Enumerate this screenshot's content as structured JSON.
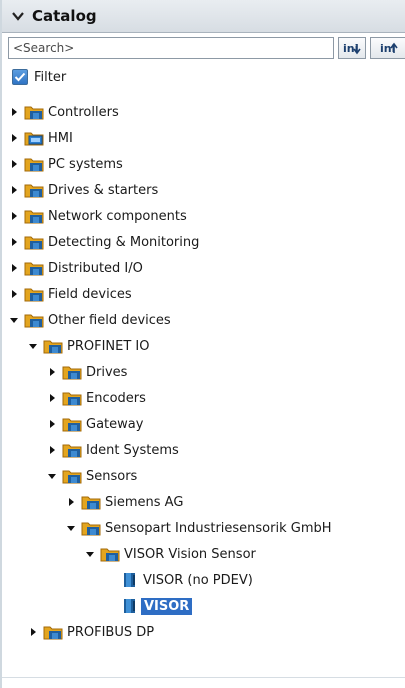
{
  "header": {
    "title": "Catalog"
  },
  "search": {
    "placeholder": "<Search>"
  },
  "filter": {
    "label": "Filter",
    "checked": true
  },
  "tree": [
    {
      "label": "Controllers",
      "level": 0,
      "state": "collapsed",
      "icon": "folder-icon"
    },
    {
      "label": "HMI",
      "level": 0,
      "state": "collapsed",
      "icon": "hmi-folder-icon"
    },
    {
      "label": "PC systems",
      "level": 0,
      "state": "collapsed",
      "icon": "folder-icon"
    },
    {
      "label": "Drives & starters",
      "level": 0,
      "state": "collapsed",
      "icon": "folder-icon"
    },
    {
      "label": "Network components",
      "level": 0,
      "state": "collapsed",
      "icon": "folder-icon"
    },
    {
      "label": "Detecting & Monitoring",
      "level": 0,
      "state": "collapsed",
      "icon": "folder-icon"
    },
    {
      "label": "Distributed I/O",
      "level": 0,
      "state": "collapsed",
      "icon": "folder-icon"
    },
    {
      "label": "Field devices",
      "level": 0,
      "state": "collapsed",
      "icon": "folder-icon"
    },
    {
      "label": "Other field devices",
      "level": 0,
      "state": "expanded",
      "icon": "folder-icon"
    },
    {
      "label": "PROFINET IO",
      "level": 1,
      "state": "expanded",
      "icon": "folder-icon"
    },
    {
      "label": "Drives",
      "level": 2,
      "state": "collapsed",
      "icon": "folder-icon"
    },
    {
      "label": "Encoders",
      "level": 2,
      "state": "collapsed",
      "icon": "folder-icon"
    },
    {
      "label": "Gateway",
      "level": 2,
      "state": "collapsed",
      "icon": "folder-icon"
    },
    {
      "label": "Ident Systems",
      "level": 2,
      "state": "collapsed",
      "icon": "folder-icon"
    },
    {
      "label": "Sensors",
      "level": 2,
      "state": "expanded",
      "icon": "folder-icon"
    },
    {
      "label": "Siemens AG",
      "level": 3,
      "state": "collapsed",
      "icon": "folder-icon"
    },
    {
      "label": "Sensopart Industriesensorik GmbH",
      "level": 3,
      "state": "expanded",
      "icon": "folder-icon"
    },
    {
      "label": "VISOR Vision Sensor",
      "level": 4,
      "state": "expanded",
      "icon": "folder-icon"
    },
    {
      "label": "VISOR (no PDEV)",
      "level": 5,
      "state": "leaf",
      "icon": "device-icon"
    },
    {
      "label": "VISOR",
      "level": 5,
      "state": "leaf",
      "icon": "device-icon",
      "selected": true
    },
    {
      "label": "PROFIBUS DP",
      "level": 1,
      "state": "collapsed",
      "icon": "folder-icon"
    }
  ]
}
